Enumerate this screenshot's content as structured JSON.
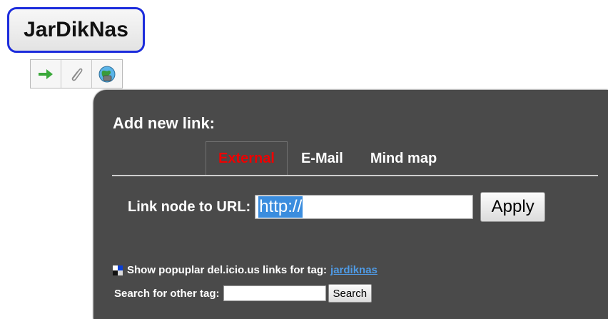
{
  "node": {
    "label": "JarDikNas"
  },
  "node_toolbar": {
    "buttons": [
      {
        "icon": "arrow-right-icon",
        "color": "#3aa83a"
      },
      {
        "icon": "paperclip-icon",
        "color": "#9a9a9a"
      },
      {
        "icon": "globe-link-icon",
        "color": "#3a8a3a"
      }
    ]
  },
  "panel": {
    "title": "Add new link:",
    "tabs": [
      {
        "label": "External",
        "active": true
      },
      {
        "label": "E-Mail",
        "active": false
      },
      {
        "label": "Mind map",
        "active": false
      }
    ],
    "url_label": "Link node to URL:",
    "url_value": "http://",
    "apply_label": "Apply",
    "delicious_text": "Show popuplar del.icio.us links for tag:",
    "delicious_tag": "jardiknas",
    "search_label": "Search for other tag:",
    "search_value": "",
    "search_button": "Search"
  },
  "colors": {
    "node_border": "#1c2cdc",
    "panel_bg": "#4a4a4a",
    "active_tab": "#ee0000",
    "link": "#4f9be6",
    "selection": "#3b8dde"
  }
}
